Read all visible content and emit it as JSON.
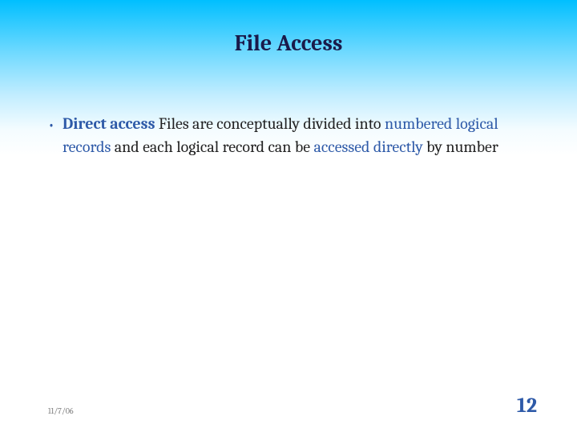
{
  "title": "File Access",
  "bullet": {
    "term": "Direct access",
    "pre": "  Files are conceptually divided into ",
    "hl1": "numbered logical records",
    "mid": " and each logical record can be ",
    "hl2": "accessed directly",
    "post": " by number"
  },
  "footer": {
    "date": "11/7/06",
    "slide_number": "12"
  }
}
